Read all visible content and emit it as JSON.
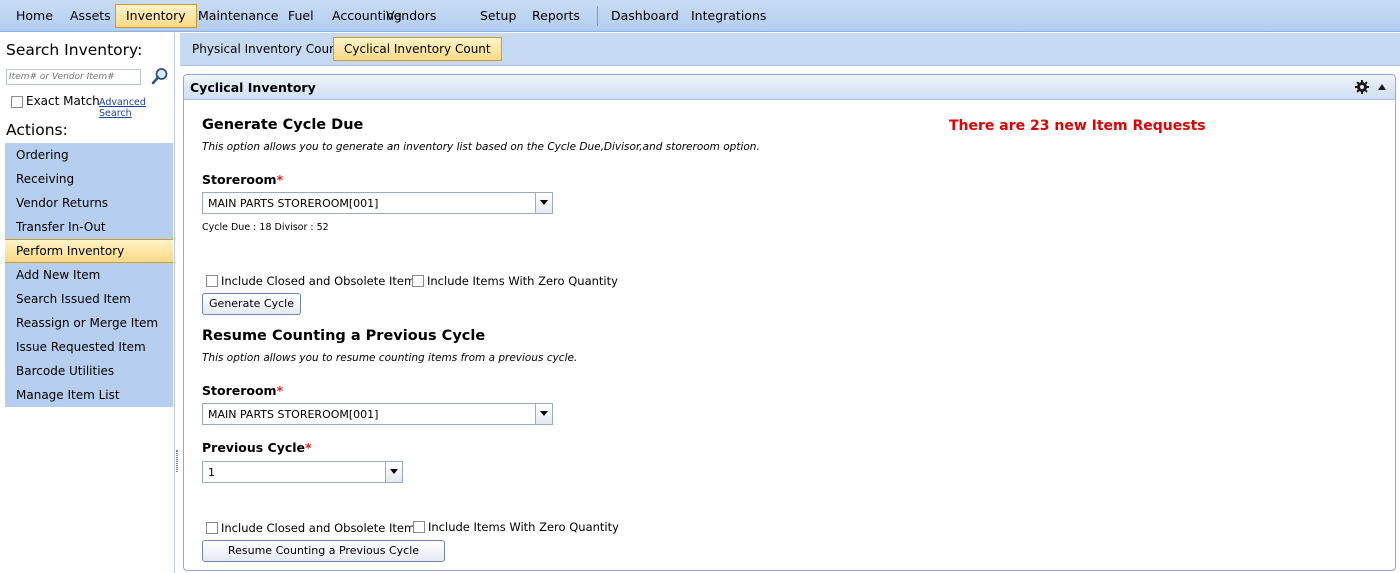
{
  "menu": {
    "items": [
      {
        "label": "Home"
      },
      {
        "label": "Assets"
      },
      {
        "label": "Inventory",
        "active": true
      },
      {
        "label": "Maintenance"
      },
      {
        "label": "Fuel"
      },
      {
        "label": "Accounting"
      },
      {
        "label": "Vendors"
      },
      {
        "label": "Setup"
      },
      {
        "label": "Reports"
      },
      {
        "label": "Dashboard"
      },
      {
        "label": "Integrations"
      }
    ]
  },
  "sidebar": {
    "search_title": "Search Inventory:",
    "search_placeholder": "Item# or Vendor Item#",
    "exact_match_label": "Exact Match",
    "advanced_search_label": "Advanced Search",
    "actions_title": "Actions:",
    "actions": [
      {
        "label": "Ordering"
      },
      {
        "label": "Receiving"
      },
      {
        "label": "Vendor Returns"
      },
      {
        "label": "Transfer In-Out"
      },
      {
        "label": "Perform Inventory",
        "active": true
      },
      {
        "label": "Add New Item"
      },
      {
        "label": "Search Issued Item"
      },
      {
        "label": "Reassign or Merge Item"
      },
      {
        "label": "Issue Requested Item"
      },
      {
        "label": "Barcode Utilities"
      },
      {
        "label": "Manage Item List"
      }
    ]
  },
  "subtabs": [
    {
      "label": "Physical Inventory Count"
    },
    {
      "label": "Cyclical Inventory Count",
      "active": true
    }
  ],
  "panel": {
    "title": "Cyclical Inventory",
    "alert": "There are 23 new Item Requests",
    "generate": {
      "heading": "Generate Cycle Due",
      "description": "This option allows you to generate an inventory list based on the Cycle Due,Divisor,and storeroom option.",
      "storeroom_label": "Storeroom",
      "required_mark": "*",
      "storeroom_value": "MAIN PARTS STOREROOM[001]",
      "cycle_info": "Cycle Due : 18 Divisor : 52",
      "include_closed_label": "Include Closed and Obsolete Items",
      "include_zero_label": "Include Items With Zero Quantity",
      "button_label": "Generate Cycle"
    },
    "resume": {
      "heading": "Resume Counting a Previous Cycle",
      "description": "This option allows you to resume counting items from a previous cycle.",
      "storeroom_label": "Storeroom",
      "required_mark": "*",
      "storeroom_value": "MAIN PARTS STOREROOM[001]",
      "previous_cycle_label": "Previous Cycle",
      "previous_cycle_value": "1",
      "include_closed_label": "Include Closed and Obsolete Items",
      "include_zero_label": "Include Items With Zero Quantity",
      "button_label": "Resume Counting a Previous Cycle"
    }
  },
  "colors": {
    "menu_bar": "#b3cdf0",
    "active_tab": "#fbd985",
    "alert": "#e40000",
    "required": "#e02020"
  },
  "icons": [
    "search-icon",
    "gear-icon",
    "collapse-up-icon",
    "dropdown-arrow-icon"
  ]
}
